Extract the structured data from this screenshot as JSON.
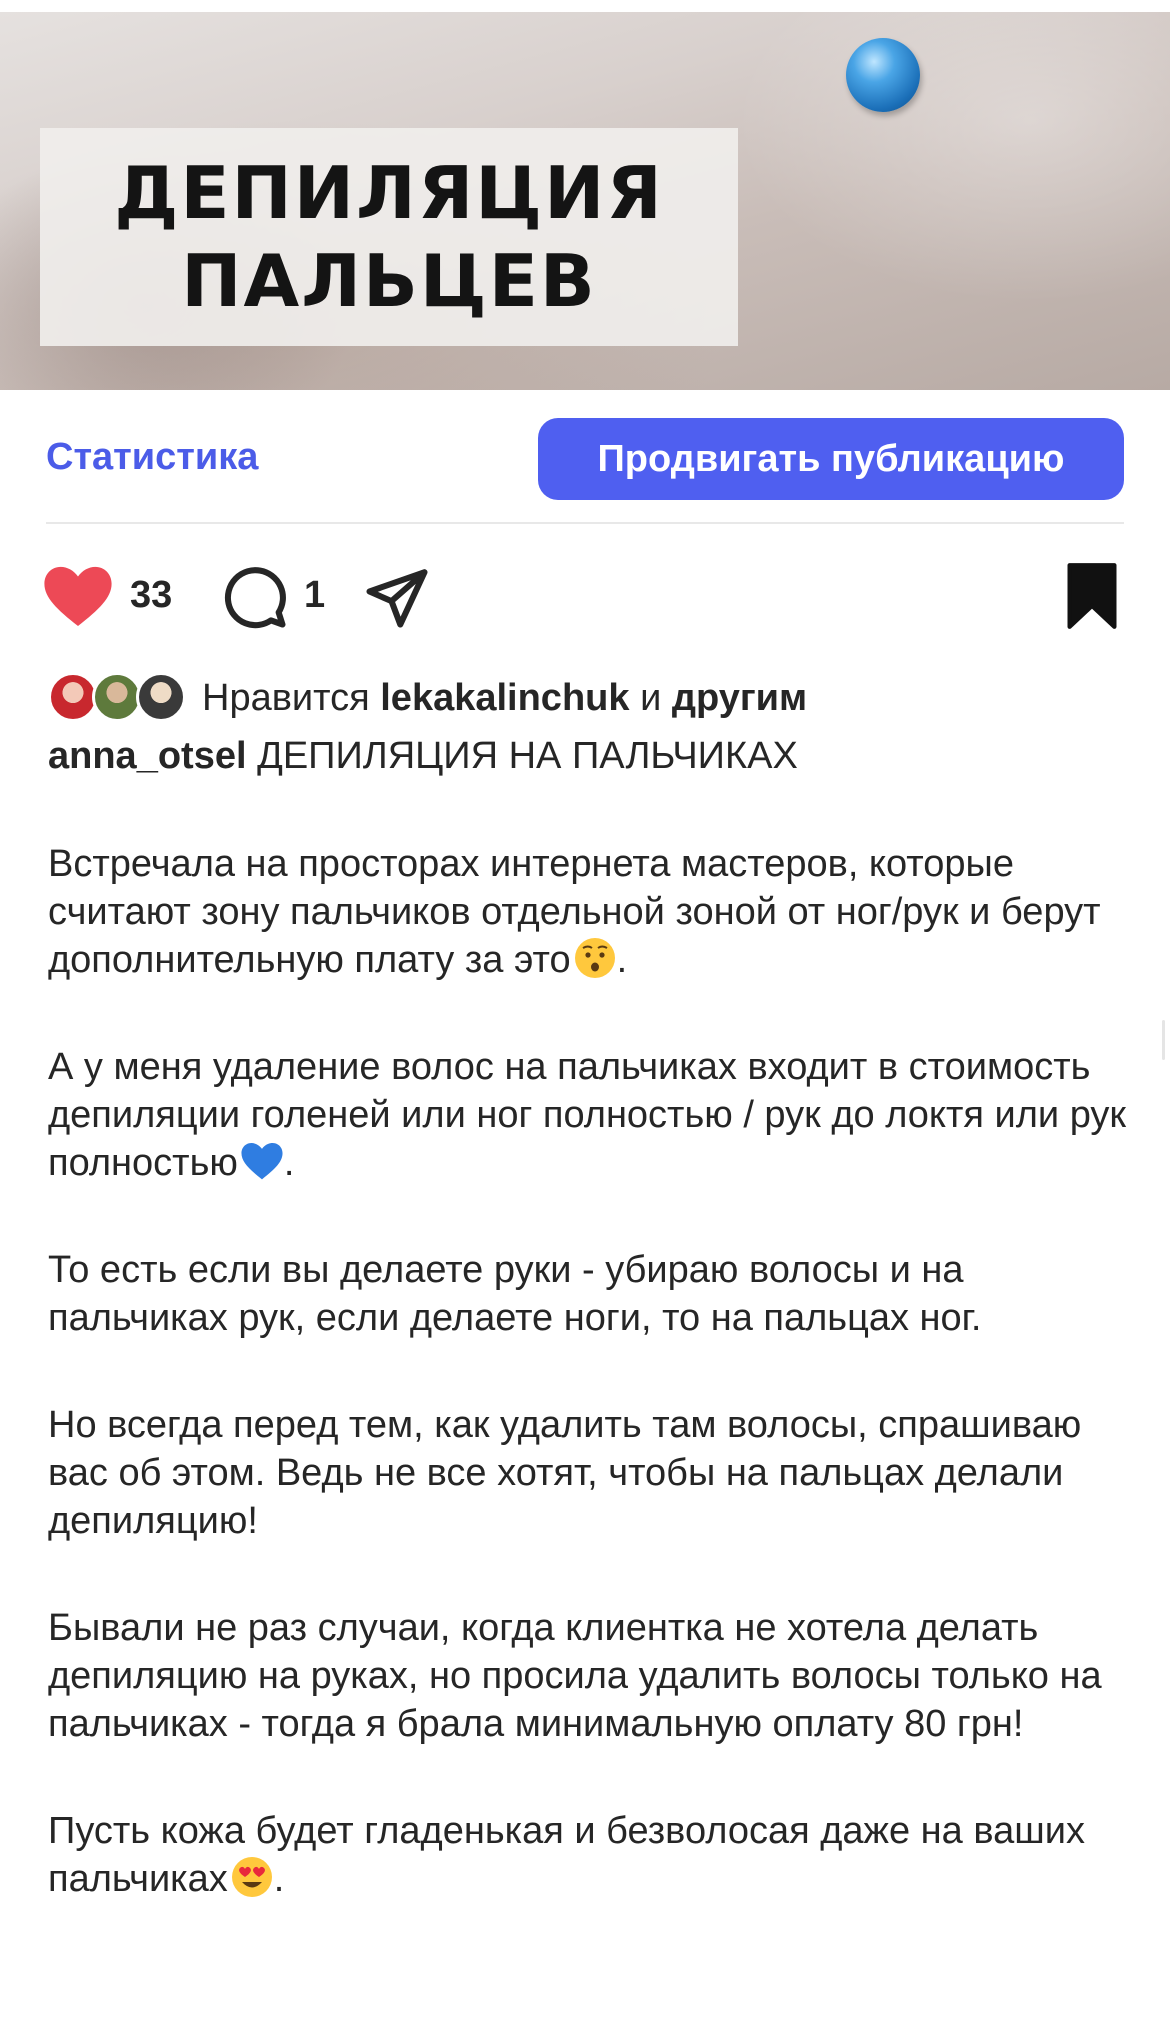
{
  "hero": {
    "title": "ДЕПИЛЯЦИЯ\nПАЛЬЦЕВ"
  },
  "actions": {
    "statistics_label": "Статистика",
    "promote_label": "Продвигать публикацию"
  },
  "engagement": {
    "likes_count": "33",
    "comments_count": "1"
  },
  "likes": {
    "prefix": "Нравится",
    "user": "lekakalinchuk",
    "connector": "и",
    "others": "другим"
  },
  "caption": {
    "username": "anna_otsel",
    "headline": "ДЕПИЛЯЦИЯ НА ПАЛЬЧИКАХ",
    "paragraphs": [
      {
        "text": "Встречала на просторах интернета мастеров, которые считают зону пальчиков отдельной зоной от ног/рук и берут дополнительную плату за это",
        "emoji": "hushed-face-emoji",
        "end": "."
      },
      {
        "text": "А у меня удаление волос на пальчиках входит в стоимость депиляции голеней или ног полностью / рук до локтя или рук полностью",
        "emoji": "blue-heart-emoji",
        "end": "."
      },
      {
        "text": "То есть если вы делаете руки - убираю волосы и на пальчиках рук, если делаете ноги, то на пальцах ног."
      },
      {
        "text": "Но всегда перед тем, как удалить там волосы, спрашиваю вас об этом. Ведь не все хотят, чтобы на пальцах делали депиляцию!"
      },
      {
        "text": "Бывали не раз случаи, когда клиентка не хотела делать депиляцию на руках, но просила удалить волосы только на пальчиках - тогда я брала минимальную оплату 80 грн!"
      },
      {
        "text": "Пусть кожа будет гладенькая и безволосая даже на ваших пальчиках",
        "emoji": "heart-eyes-emoji",
        "end": "."
      }
    ]
  },
  "colors": {
    "accent": "#4f5ff0",
    "link": "#4b5ce8",
    "like": "#ed4956",
    "text": "#262626"
  }
}
